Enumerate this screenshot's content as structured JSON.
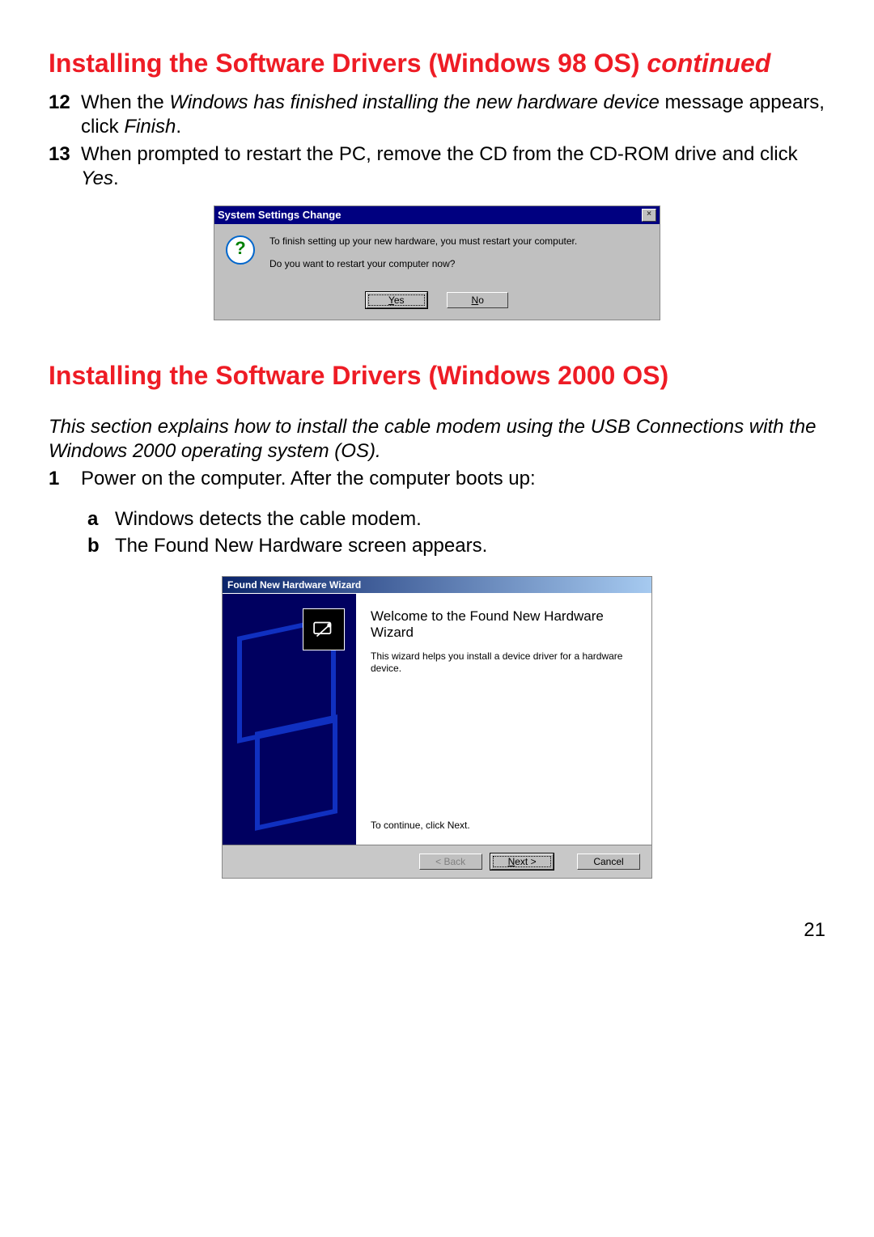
{
  "heading1_main": "Installing the Software Drivers (Windows 98 OS)",
  "heading1_cont": "continued",
  "steps98": [
    {
      "num": "12",
      "parts": [
        {
          "t": "When the ",
          "i": false
        },
        {
          "t": "Windows has finished installing the new hardware device",
          "i": true
        },
        {
          "t": " message appears, click ",
          "i": false
        },
        {
          "t": "Finish",
          "i": true
        },
        {
          "t": ".",
          "i": false
        }
      ]
    },
    {
      "num": "13",
      "parts": [
        {
          "t": "When prompted to restart the PC, remove the CD from the CD-ROM drive and click ",
          "i": false
        },
        {
          "t": "Yes",
          "i": true
        },
        {
          "t": ".",
          "i": false
        }
      ]
    }
  ],
  "dlg1": {
    "title": "System Settings Change",
    "close_glyph": "×",
    "icon_glyph": "?",
    "msg1": "To finish setting up your new hardware, you must restart your computer.",
    "msg2": "Do you want to restart your computer now?",
    "yes": "Yes",
    "no": "No"
  },
  "heading2": "Installing the Software Drivers (Windows 2000 OS)",
  "intro2000": "This section explains how to install the cable modem using the USB Connections with the Windows 2000 operating system (OS).",
  "steps2000": [
    {
      "num": "1",
      "text": "Power on the computer. After the computer boots up:"
    }
  ],
  "sub2000": [
    {
      "let": "a",
      "parts": [
        {
          "t": "Windows detects the cable modem.",
          "i": false
        }
      ]
    },
    {
      "let": "b",
      "parts": [
        {
          "t": "The ",
          "i": false
        },
        {
          "t": "Found New Hardware",
          "i": true
        },
        {
          "t": " screen appears.",
          "i": false
        }
      ]
    }
  ],
  "dlg2": {
    "title": "Found New Hardware Wizard",
    "wiz_title": "Welcome to the Found New Hardware Wizard",
    "wiz_text": "This wizard helps you install a device driver for a hardware device.",
    "continue_text": "To continue, click Next.",
    "back": "< Back",
    "next": "Next >",
    "cancel": "Cancel"
  },
  "page_number": "21"
}
